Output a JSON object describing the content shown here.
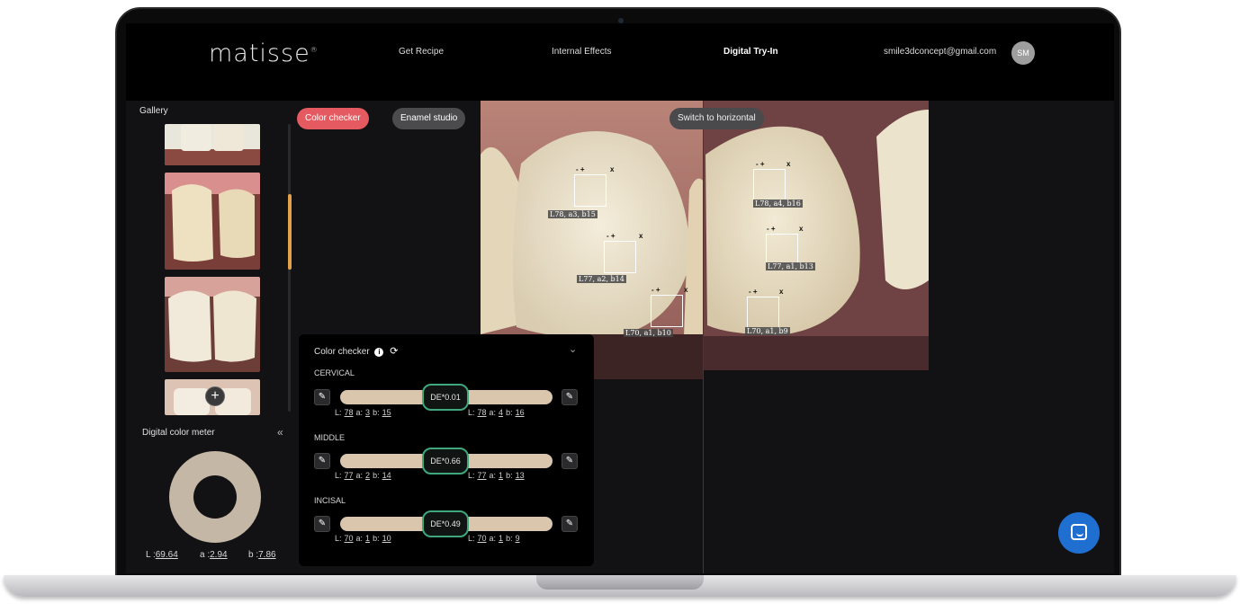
{
  "header": {
    "logo": "matisse",
    "nav": [
      "Get Recipe",
      "Internal Effects",
      "Digital Try-In"
    ],
    "active_nav": "Digital Try-In",
    "user_email": "smile3dconcept@gmail.com",
    "avatar_initials": "SM"
  },
  "sidebar": {
    "gallery_title": "Gallery",
    "add_icon": "plus-icon",
    "meter_title": "Digital color meter",
    "collapse_icon": "chevron-left-icon",
    "lab": {
      "L_label": "L :",
      "L_value": "69.64",
      "a_label": "a :",
      "a_value": "2.94",
      "b_label": "b :",
      "b_value": "7.86"
    },
    "ring_color": "#c5b7a5"
  },
  "toolbar": {
    "color_checker": "Color checker",
    "enamel_studio": "Enamel studio",
    "switch": "Switch to horizontal"
  },
  "image_labels": {
    "left": [
      "L78, a3, b15",
      "L77, a2, b14",
      "L70, a1, b10"
    ],
    "right": [
      "L78, a4, b16",
      "L77, a1, b13",
      "L70, a1, b9"
    ]
  },
  "color_checker": {
    "title": "Color checker",
    "info_icon": "info-icon",
    "refresh_icon": "refresh-icon",
    "collapse_icon": "chevron-down-icon",
    "sections": [
      {
        "name": "CERVICAL",
        "de": "DE*0.01",
        "left": {
          "L": "78",
          "a": "3",
          "b": "15"
        },
        "right": {
          "L": "78",
          "a": "4",
          "b": "16"
        }
      },
      {
        "name": "MIDDLE",
        "de": "DE*0.66",
        "left": {
          "L": "77",
          "a": "2",
          "b": "14"
        },
        "right": {
          "L": "77",
          "a": "1",
          "b": "13"
        }
      },
      {
        "name": "INCISAL",
        "de": "DE*0.49",
        "left": {
          "L": "70",
          "a": "1",
          "b": "10"
        },
        "right": {
          "L": "70",
          "a": "1",
          "b": "9"
        }
      }
    ],
    "accent": "#3fa77e",
    "bar_color": "#d9c6ad"
  },
  "chat": {
    "icon": "chat-icon",
    "color": "#1f6fd1"
  }
}
